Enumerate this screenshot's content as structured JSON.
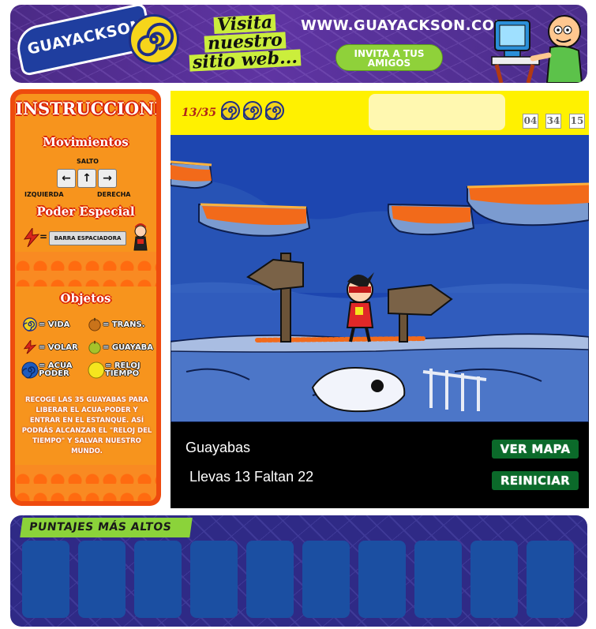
{
  "banner": {
    "logo_text": "GUAYACKSON",
    "visita_lines": [
      "Visita",
      "nuestro",
      "sitio web..."
    ],
    "site_url": "WWW.GUAYACKSON.COM",
    "invite_label": "INVITA A TUS AMIGOS"
  },
  "instructions": {
    "title": "INSTRUCCIONES",
    "movement_heading": "Movimientos",
    "jump_label": "SALTO",
    "left_label": "IZQUIERDA",
    "right_label": "DERECHA",
    "special_heading": "Poder Especial",
    "spacebar_label": "BARRA ESPACIADORA",
    "objects_heading": "Objetos",
    "objects": [
      {
        "label": "= VIDA",
        "icon": "swirl-life-icon",
        "color": "#f2d31b"
      },
      {
        "label": "= TRANS.",
        "icon": "trans-guava-icon",
        "color": "#c9731a"
      },
      {
        "label": "= VOLAR",
        "icon": "lightning-fly-icon",
        "color": "#d8261a"
      },
      {
        "label": "= GUAYABA",
        "icon": "guava-icon",
        "color": "#a6c22a"
      },
      {
        "label": "= ACUA PODER",
        "icon": "water-power-icon",
        "color": "#1d5bbf"
      },
      {
        "label": "= RELOJ TIEMPO",
        "icon": "time-clock-icon",
        "color": "#f5e51e"
      }
    ],
    "story": "RECOGE LAS 35 GUAYABAS PARA LIBERAR EL ACUA-PODER Y ENTRAR EN EL ESTANQUE. ASÍ PODRÁS ALCANZAR EL \"RELOJ DEL TIEMPO\" Y SALVAR NUESTRO MUNDO."
  },
  "hud": {
    "collected": "13",
    "total": "/35",
    "lives": 3,
    "timer": [
      "04",
      "34",
      "15"
    ]
  },
  "status": {
    "title": "Guayabas",
    "line": "Llevas 13 Faltan 22",
    "map_button": "VER MAPA",
    "restart_button": "REINICIAR"
  },
  "scores": {
    "title": "PUNTAJES MÁS ALTOS",
    "slots": 10
  },
  "colors": {
    "hud_yellow": "#fff100",
    "button_green": "#0b6a2a",
    "panel_orange": "#ee4b0e",
    "banner_purple": "#5f34a2"
  }
}
